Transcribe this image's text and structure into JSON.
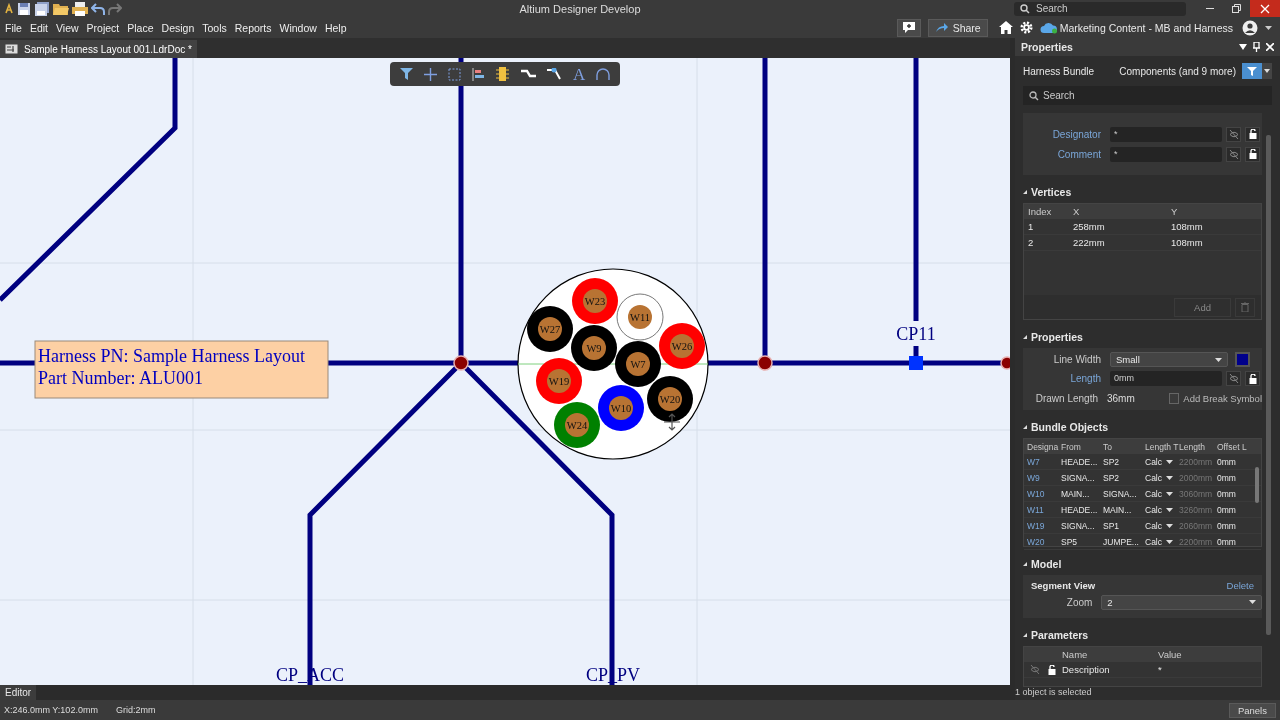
{
  "title_bar": {
    "title": "Altium Designer Develop",
    "search": {
      "placeholder": "Search"
    }
  },
  "menu": [
    "File",
    "Edit",
    "View",
    "Project",
    "Place",
    "Design",
    "Tools",
    "Reports",
    "Window",
    "Help"
  ],
  "top_actions": {
    "share": "Share",
    "workspace": "Marketing Content - MB and Harness"
  },
  "document_tab": {
    "label": "Sample Harness Layout 001.LdrDoc *",
    "selected": true
  },
  "canvas_toolbar": {
    "text_tool": "A"
  },
  "canvas": {
    "label_box": [
      "Harness PN: Sample Harness Layout",
      "Part Number: ALU001"
    ],
    "port_labels": [
      "CP11",
      "CP_ACC",
      "CP_PV"
    ],
    "bundle": {
      "wires": [
        {
          "name": "W23",
          "color": "#ff0000"
        },
        {
          "name": "W11",
          "color": "#ffffff"
        },
        {
          "name": "W27",
          "color": "#000000"
        },
        {
          "name": "W9",
          "color": "#000000"
        },
        {
          "name": "W26",
          "color": "#ff0000"
        },
        {
          "name": "W7",
          "color": "#000000"
        },
        {
          "name": "W19",
          "color": "#ff0000"
        },
        {
          "name": "W10",
          "color": "#0000ff"
        },
        {
          "name": "W20",
          "color": "#000000"
        },
        {
          "name": "W24",
          "color": "#008000"
        }
      ]
    }
  },
  "editor_tab": "Editor",
  "properties": {
    "title": "Properties",
    "object_type": "Harness Bundle",
    "filter": "Components (and 9 more)",
    "search": {
      "placeholder": "Search"
    },
    "general": [
      {
        "label": "Designator",
        "value": "*"
      },
      {
        "label": "Comment",
        "value": "*"
      }
    ],
    "vertices": {
      "title": "Vertices",
      "columns": [
        "Index",
        "X",
        "Y"
      ],
      "rows": [
        [
          "1",
          "258mm",
          "108mm"
        ],
        [
          "2",
          "222mm",
          "108mm"
        ]
      ],
      "add_button": {
        "label": "Add",
        "disabled": true
      }
    },
    "line": {
      "title": "Properties",
      "line_width": {
        "label": "Line Width",
        "value": "Small"
      },
      "length": {
        "label": "Length",
        "value": "0mm"
      },
      "drawn_length": {
        "label": "Drawn Length",
        "value": "36mm"
      },
      "break_symbol": {
        "label": "Add Break Symbol",
        "checked": false
      }
    },
    "bundle_objects": {
      "title": "Bundle Objects",
      "columns": [
        "Designa",
        "From",
        "To",
        "Length T",
        "Length",
        "Offset L"
      ],
      "rows": [
        [
          "W7",
          "HEADE...",
          "SP2",
          "Calc",
          "2200mm",
          "0mm"
        ],
        [
          "W9",
          "SIGNA...",
          "SP2",
          "Calc",
          "2000mm",
          "0mm"
        ],
        [
          "W10",
          "MAIN...",
          "SIGNA...",
          "Calc",
          "3060mm",
          "0mm"
        ],
        [
          "W11",
          "HEADE...",
          "MAIN...",
          "Calc",
          "3260mm",
          "0mm"
        ],
        [
          "W19",
          "SIGNA...",
          "SP1",
          "Calc",
          "2060mm",
          "0mm"
        ],
        [
          "W20",
          "SP5",
          "JUMPE...",
          "Calc",
          "2200mm",
          "0mm"
        ]
      ]
    },
    "model": {
      "title": "Model",
      "segment_view": "Segment View",
      "delete": "Delete",
      "zoom": {
        "label": "Zoom",
        "value": "2"
      }
    },
    "parameters": {
      "title": "Parameters",
      "columns": [
        "Name",
        "Value"
      ],
      "rows": [
        {
          "name": "Description",
          "value": "*"
        }
      ]
    },
    "selection_status": "1 object is selected"
  },
  "status_bar": {
    "coords": "X:246.0mm Y:102.0mm",
    "grid": "Grid:2mm",
    "panels_button": "Panels"
  }
}
